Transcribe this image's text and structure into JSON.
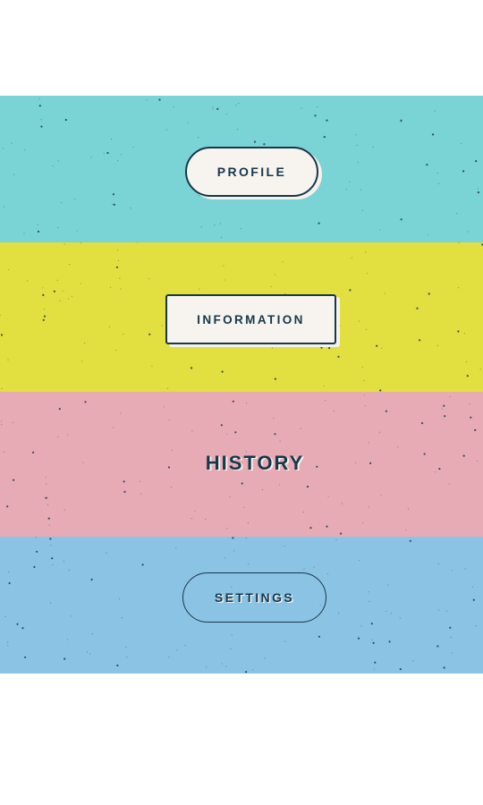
{
  "menu": {
    "items": [
      {
        "label": "PROFILE",
        "band_color": "#7ad3d4",
        "button_fill": "#f7f4ef",
        "style": "pill-filled"
      },
      {
        "label": "INFORMATION",
        "band_color": "#e2df41",
        "button_fill": "#f7f4ef",
        "style": "rect-filled"
      },
      {
        "label": "HISTORY",
        "band_color": "#e7abb5",
        "button_fill": "",
        "style": "text-only"
      },
      {
        "label": "SETTINGS",
        "band_color": "#8bc3e4",
        "button_fill": "",
        "style": "pill-outline"
      }
    ]
  },
  "colors": {
    "page_background": "#ffffff",
    "text_dark": "#17374a",
    "speckle": "#1f3a4b",
    "highlight": "#f5f2ec"
  }
}
